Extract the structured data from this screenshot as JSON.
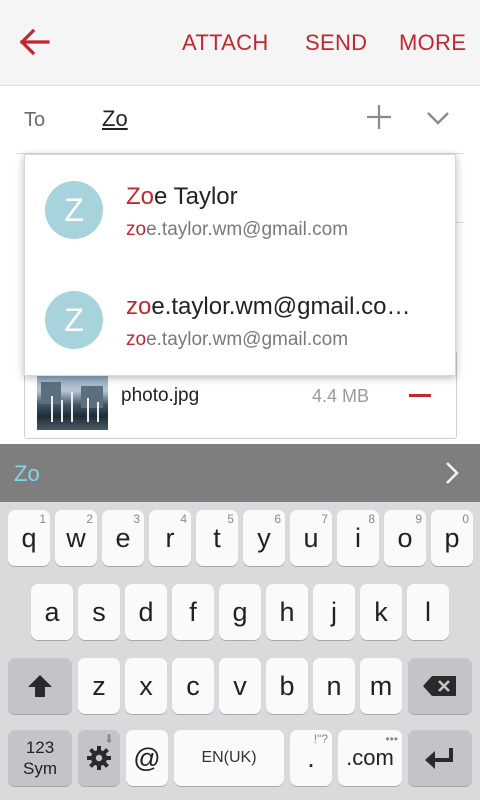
{
  "appbar": {
    "attach_label": "ATTACH",
    "send_label": "SEND",
    "more_label": "MORE",
    "accent_color": "#c0282f"
  },
  "compose": {
    "to_label": "To",
    "to_value": "Zo"
  },
  "suggestions": [
    {
      "avatar_letter": "Z",
      "name_match": "Zo",
      "name_rest": "e Taylor",
      "email_match": "zo",
      "email_rest": "e.taylor.wm@gmail.com"
    },
    {
      "avatar_letter": "Z",
      "name_match": "zo",
      "name_rest": "e.taylor.wm@gmail.co…",
      "email_match": "zo",
      "email_rest": "e.taylor.wm@gmail.com"
    }
  ],
  "attachment": {
    "file_name": "photo.jpg",
    "file_size": "4.4 MB"
  },
  "keyboard": {
    "suggestion": "Zo",
    "row1": [
      {
        "key": "q",
        "hint": "1"
      },
      {
        "key": "w",
        "hint": "2"
      },
      {
        "key": "e",
        "hint": "3"
      },
      {
        "key": "r",
        "hint": "4"
      },
      {
        "key": "t",
        "hint": "5"
      },
      {
        "key": "y",
        "hint": "6"
      },
      {
        "key": "u",
        "hint": "7"
      },
      {
        "key": "i",
        "hint": "8"
      },
      {
        "key": "o",
        "hint": "9"
      },
      {
        "key": "p",
        "hint": "0"
      }
    ],
    "row2": [
      "a",
      "s",
      "d",
      "f",
      "g",
      "h",
      "j",
      "k",
      "l"
    ],
    "row3": [
      "z",
      "x",
      "c",
      "v",
      "b",
      "n",
      "m"
    ],
    "sym_top": "123",
    "sym_bottom": "Sym",
    "at": "@",
    "space_label": "EN(UK)",
    "period": ".",
    "period_hint": "!\"?",
    "dotcom": ".com"
  }
}
